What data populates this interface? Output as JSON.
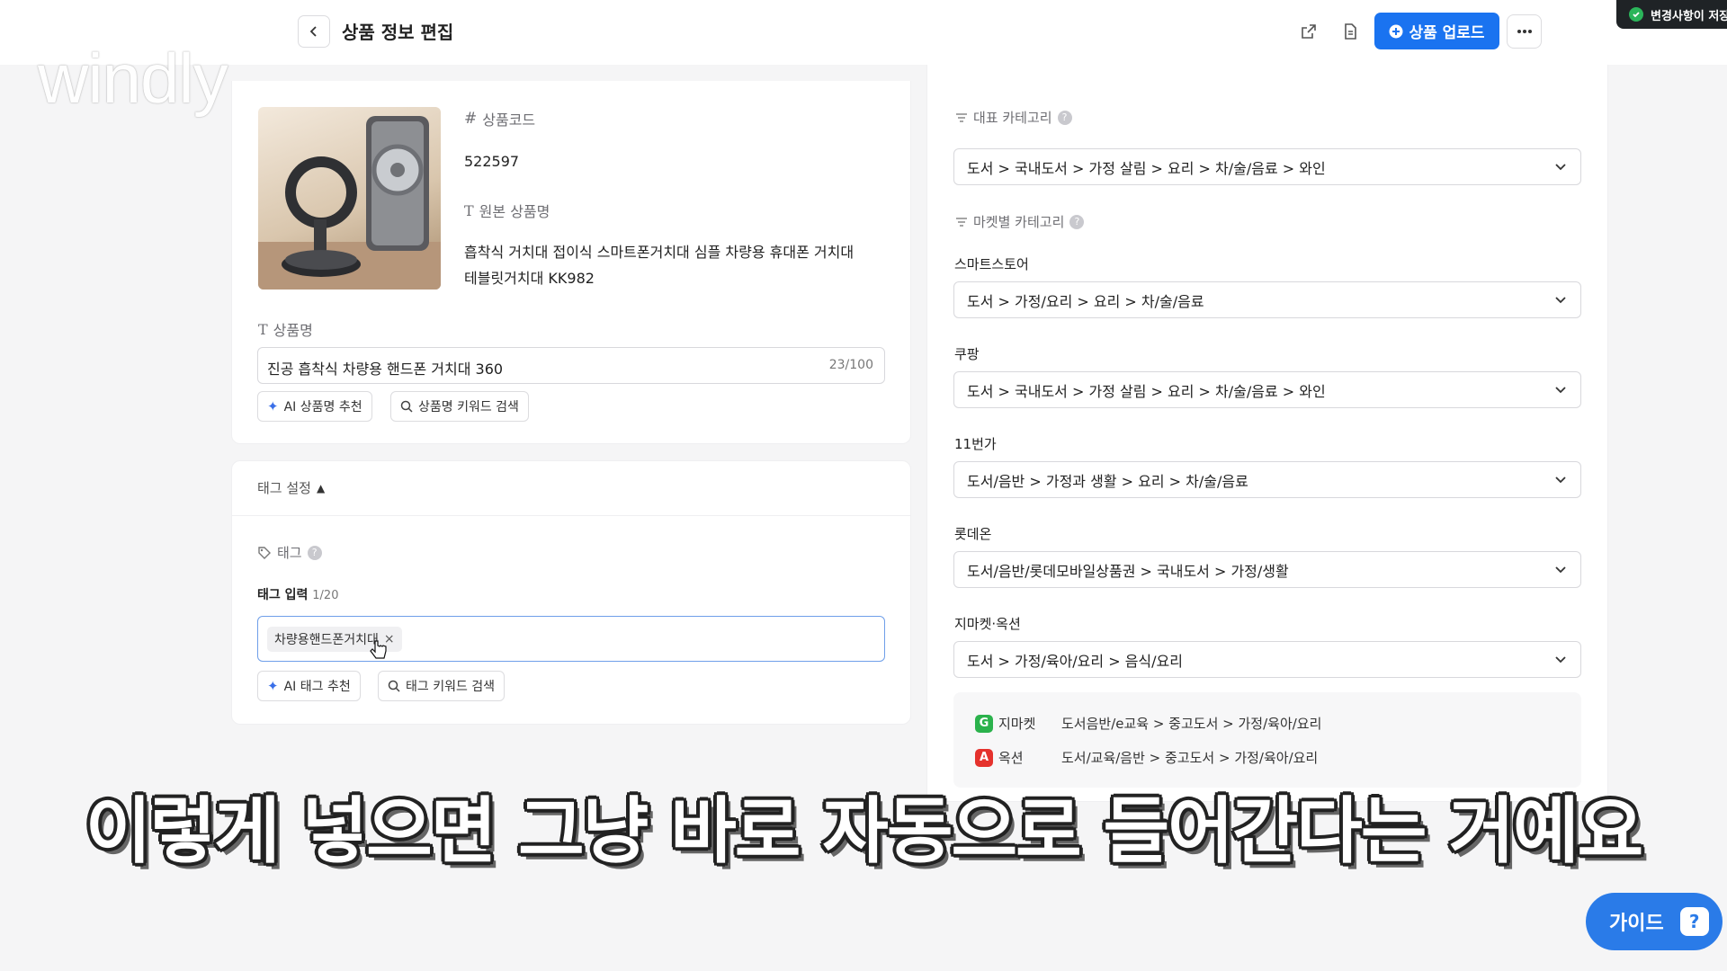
{
  "header": {
    "title": "상품 정보 편집",
    "upload_label": "상품 업로드",
    "more_label": "···",
    "toast": "변경사항이 저장됨"
  },
  "watermark": "windly",
  "product": {
    "code_label": "상품코드",
    "code_value": "522597",
    "original_name_label": "원본 상품명",
    "original_name_line1": "흡착식 거치대 접이식 스마트폰거치대 심플 차량용 휴대폰 거치대",
    "original_name_line2": "테블릿거치대 KK982",
    "name_label": "상품명",
    "name_value": "진공 흡착식 차량용 핸드폰 거치대 360",
    "name_counter": "23/100",
    "ai_name_btn": "AI 상품명 추천",
    "name_keyword_btn": "상품명 키워드 검색"
  },
  "tags": {
    "section_title": "태그 설정",
    "tag_label": "태그",
    "input_label": "태그 입력",
    "input_counter": "1/20",
    "chips": [
      "차량용핸드폰거치대"
    ],
    "ai_tag_btn": "AI 태그 추천",
    "tag_keyword_btn": "태그 키워드 검색"
  },
  "categories": {
    "main_label": "대표 카테고리",
    "main_value": "도서 > 국내도서 > 가정 살림 > 요리 > 차/술/음료 > 와인",
    "market_label": "마켓별 카테고리",
    "markets": [
      {
        "name": "스마트스토어",
        "value": "도서 > 가정/요리 > 요리 > 차/술/음료"
      },
      {
        "name": "쿠팡",
        "value": "도서 > 국내도서 > 가정 살림 > 요리 > 차/술/음료 > 와인"
      },
      {
        "name": "11번가",
        "value": "도서/음반 > 가정과 생활 > 요리 > 차/술/음료"
      },
      {
        "name": "롯데온",
        "value": "도서/음반/롯데모바일상품권 > 국내도서 > 가정/생활"
      },
      {
        "name": "지마켓·옥션",
        "value": "도서 > 가정/육아/요리 > 음식/요리"
      }
    ],
    "sub_markets": [
      {
        "badge": "G",
        "name": "지마켓",
        "value": "도서음반/e교육 > 중고도서 > 가정/육아/요리",
        "color": "#2bb24c"
      },
      {
        "badge": "A",
        "name": "옥션",
        "value": "도서/교육/음반 > 중고도서 > 가정/육아/요리",
        "color": "#e5322d"
      }
    ]
  },
  "subtitle": "이렇게 넣으면 그냥 바로 자동으로 들어간다는 거예요",
  "guide_label": "가이드",
  "colors": {
    "accent": "#1a73f0",
    "guide": "#2a7be8"
  }
}
